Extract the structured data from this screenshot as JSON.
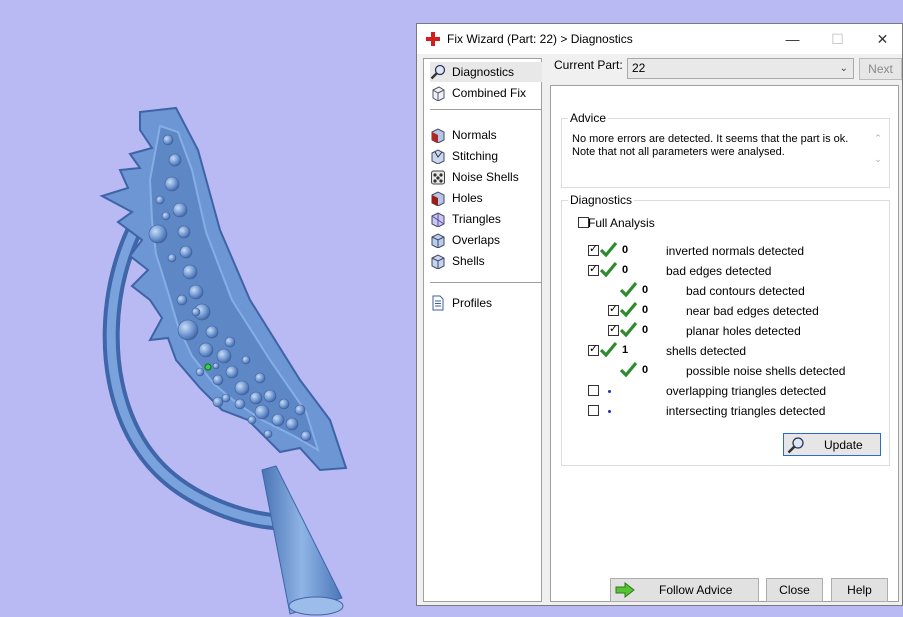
{
  "window": {
    "title": "Fix Wizard (Part: 22) > Diagnostics",
    "minimize": "—",
    "maximize": "☐",
    "close": "✕"
  },
  "nav": {
    "items": [
      {
        "label": "Diagnostics",
        "icon": "magnifier-icon",
        "selected": true
      },
      {
        "label": "Combined Fix",
        "icon": "cube-outline-icon"
      },
      {
        "label": "Normals",
        "icon": "normals-cube-icon"
      },
      {
        "label": "Stitching",
        "icon": "stitching-cube-icon"
      },
      {
        "label": "Noise Shells",
        "icon": "noise-shells-icon"
      },
      {
        "label": "Holes",
        "icon": "holes-cube-icon"
      },
      {
        "label": "Triangles",
        "icon": "triangles-cube-icon"
      },
      {
        "label": "Overlaps",
        "icon": "overlaps-cube-icon"
      },
      {
        "label": "Shells",
        "icon": "shells-cube-icon"
      },
      {
        "label": "Profiles",
        "icon": "document-icon"
      }
    ]
  },
  "current_part": {
    "label": "Current Part:",
    "value": "22",
    "next_label": "Next"
  },
  "advice": {
    "title": "Advice",
    "line1": "No more errors are detected. It seems that the part is ok.",
    "line2": "Note that not all parameters were analysed."
  },
  "diagnostics": {
    "title": "Diagnostics",
    "full_analysis_label": "Full Analysis",
    "rows": [
      {
        "checked": true,
        "status": "ok",
        "count": "0",
        "label": "inverted normals detected"
      },
      {
        "checked": true,
        "status": "ok",
        "count": "0",
        "label": "bad edges detected"
      },
      {
        "checked": null,
        "status": "ok",
        "count": "0",
        "label": "bad contours detected"
      },
      {
        "checked": true,
        "status": "ok",
        "count": "0",
        "label": "near bad edges detected"
      },
      {
        "checked": true,
        "status": "ok",
        "count": "0",
        "label": "planar holes detected"
      },
      {
        "checked": true,
        "status": "ok",
        "count": "1",
        "label": "shells detected"
      },
      {
        "checked": null,
        "status": "ok",
        "count": "0",
        "label": "possible noise shells detected"
      },
      {
        "checked": false,
        "status": "pending",
        "count": "",
        "label": "overlapping triangles detected"
      },
      {
        "checked": false,
        "status": "pending",
        "count": "",
        "label": "intersecting triangles detected"
      }
    ],
    "update_label": "Update"
  },
  "buttons": {
    "follow_advice": "Follow Advice",
    "close": "Close",
    "help": "Help"
  },
  "colors": {
    "background": "#b9b9f4",
    "model": "#6f9ad6",
    "check_green": "#2e8b2e",
    "accent_red": "#d11f1f"
  }
}
